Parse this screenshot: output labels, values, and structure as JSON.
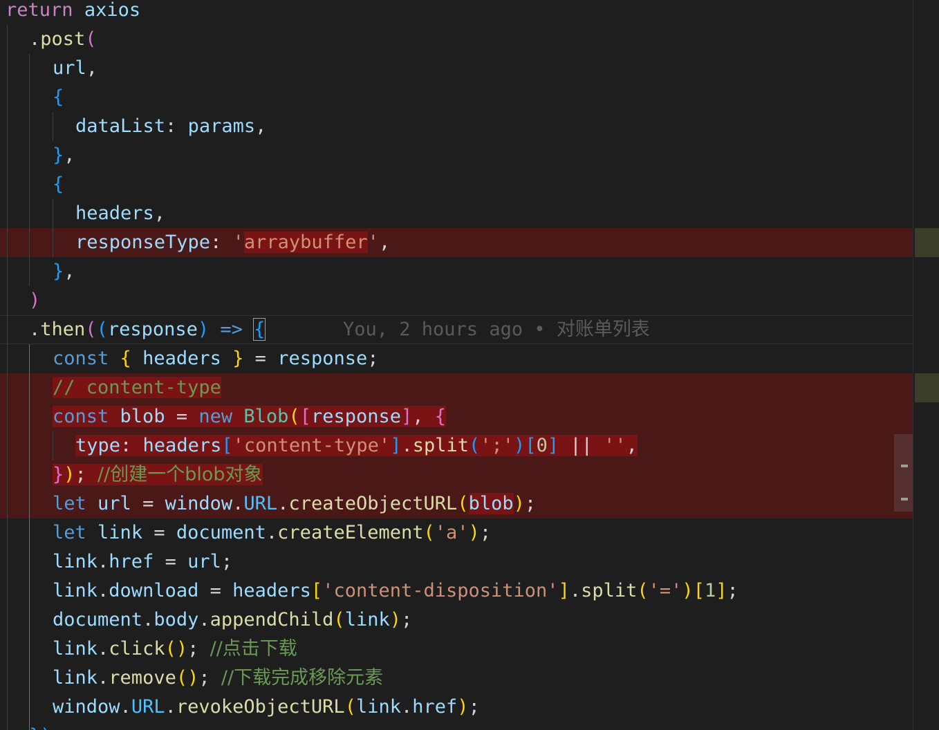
{
  "editor": {
    "language": "javascript",
    "blame": {
      "text": "You, 2 hours ago • ",
      "message": "对账单列表"
    },
    "lines": {
      "l1": {
        "kw": "return",
        "sp": " ",
        "obj": "axios"
      },
      "l2": {
        "dot": ".",
        "fn": "post",
        "paren": "("
      },
      "l3": {
        "var": "url",
        "punct": ","
      },
      "l4": {
        "brace": "{"
      },
      "l5": {
        "key": "dataList",
        "colon": ": ",
        "val": "params",
        "punct": ","
      },
      "l6": {
        "brace": "}",
        "punct": ","
      },
      "l7": {
        "brace": "{"
      },
      "l8": {
        "var": "headers",
        "punct": ","
      },
      "l9": {
        "key": "responseType",
        "colon": ": ",
        "q1": "'",
        "str": "arraybuffer",
        "q2": "'",
        "punct": ","
      },
      "l10": {
        "brace": "}",
        "punct": ","
      },
      "l11": {
        "paren": ")"
      },
      "l12": {
        "dot": ".",
        "fn": "then",
        "p1": "(",
        "p2": "(",
        "param": "response",
        "p3": ")",
        "arrow": " => ",
        "brace": "{"
      },
      "l13": {
        "kw": "const",
        "b1": "{",
        "var": "headers",
        "b2": "}",
        "eq": " = ",
        "val": "response",
        "semi": ";"
      },
      "l14": {
        "comment": "// content-type"
      },
      "l15": {
        "kw": "const",
        "var": "blob",
        "eq": " = ",
        "new": "new",
        "cls": "Blob",
        "p1": "(",
        "b1": "[",
        "arg": "response",
        "b2": "]",
        "comma": ", ",
        "b3": "{"
      },
      "l16": {
        "key": "type",
        "colon": ": ",
        "obj": "headers",
        "b1": "[",
        "str": "'content-type'",
        "b2": "]",
        "dot": ".",
        "fn": "split",
        "p1": "(",
        "arg": "';'",
        "p2": ")",
        "b3": "[",
        "num": "0",
        "b4": "]",
        "or": " || ",
        "empty": "''",
        "punct": ","
      },
      "l17": {
        "b1": "}",
        "p1": ")",
        "semi": "; ",
        "comment": "//创建一个blob对象"
      },
      "l18": {
        "kw": "let",
        "var": "url",
        "eq": " = ",
        "obj": "window",
        "dot1": ".",
        "cst": "URL",
        "dot2": ".",
        "fn": "createObjectURL",
        "p1": "(",
        "arg": "blob",
        "p2": ")",
        "semi": ";"
      },
      "l19": {
        "kw": "let",
        "var": "link",
        "eq": " = ",
        "obj": "document",
        "dot": ".",
        "fn": "createElement",
        "p1": "(",
        "arg": "'a'",
        "p2": ")",
        "semi": ";"
      },
      "l20": {
        "obj": "link",
        "dot": ".",
        "prop": "href",
        "eq": " = ",
        "val": "url",
        "semi": ";"
      },
      "l21": {
        "obj": "link",
        "dot": ".",
        "prop": "download",
        "eq": " = ",
        "val": "headers",
        "b1": "[",
        "str": "'content-disposition'",
        "b2": "]",
        "dot2": ".",
        "fn": "split",
        "p1": "(",
        "arg": "'='",
        "p2": ")",
        "b3": "[",
        "num": "1",
        "b4": "]",
        "semi": ";"
      },
      "l22": {
        "obj": "document",
        "dot": ".",
        "prop": "body",
        "dot2": ".",
        "fn": "appendChild",
        "p1": "(",
        "arg": "link",
        "p2": ")",
        "semi": ";"
      },
      "l23": {
        "obj": "link",
        "dot": ".",
        "fn": "click",
        "p": "()",
        "semi": "; ",
        "comment": "//点击下载"
      },
      "l24": {
        "obj": "link",
        "dot": ".",
        "fn": "remove",
        "p": "()",
        "semi": "; ",
        "comment": "//下载完成移除元素"
      },
      "l25": {
        "obj": "window",
        "dot": ".",
        "cst": "URL",
        "dot2": ".",
        "fn": "revokeObjectURL",
        "p1": "(",
        "arg": "link",
        "dot3": ".",
        "prop": "href",
        "p2": ")",
        "semi": ";"
      },
      "l26": {
        "close": "})"
      }
    }
  },
  "colors": {
    "background": "#1e1e1e",
    "deleted_line": "#4b1818",
    "deleted_word": "#7a1313",
    "keyword": "#569cd6",
    "control": "#c586c0",
    "variable": "#9cdcfe",
    "function": "#dcdcaa",
    "string": "#ce9178",
    "comment": "#6a9955"
  }
}
